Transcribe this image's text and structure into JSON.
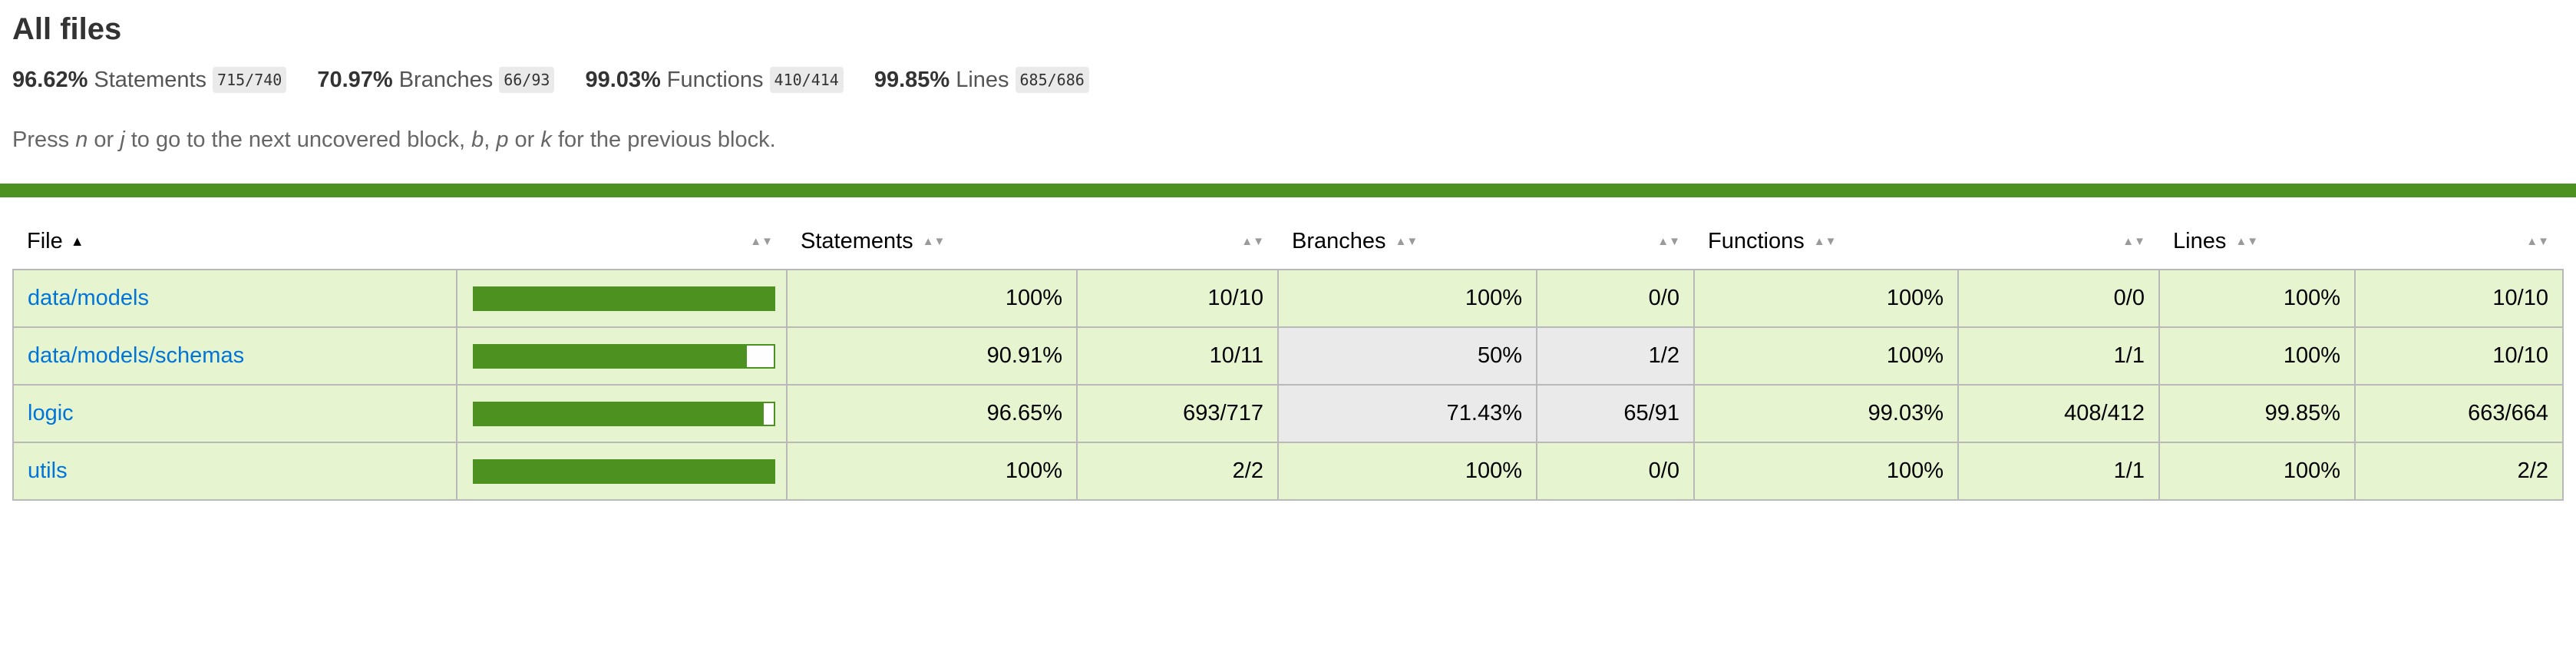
{
  "page": {
    "title": "All files",
    "hint_parts": [
      "Press ",
      "n",
      " or ",
      "j",
      " to go to the next uncovered block, ",
      "b",
      ", ",
      "p",
      " or ",
      "k",
      " for the previous block."
    ]
  },
  "summary": [
    {
      "pct": "96.62%",
      "label": "Statements",
      "fraction": "715/740"
    },
    {
      "pct": "70.97%",
      "label": "Branches",
      "fraction": "66/93"
    },
    {
      "pct": "99.03%",
      "label": "Functions",
      "fraction": "410/414"
    },
    {
      "pct": "99.85%",
      "label": "Lines",
      "fraction": "685/686"
    }
  ],
  "colors": {
    "accent_green": "#4d9221",
    "high_bg": "#e6f5d0",
    "low_bg": "#eaeaea",
    "link": "#0074d9"
  },
  "table": {
    "headers": {
      "file": "File",
      "statements": "Statements",
      "branches": "Branches",
      "functions": "Functions",
      "lines": "Lines"
    },
    "rows": [
      {
        "file": "data/models",
        "coverage_fraction": 1.0,
        "statements_pct": "100%",
        "statements": "10/10",
        "branches_pct": "100%",
        "branches": "0/0",
        "functions_pct": "100%",
        "functions": "0/0",
        "lines_pct": "100%",
        "lines": "10/10",
        "branches_low": false
      },
      {
        "file": "data/models/schemas",
        "coverage_fraction": 0.9091,
        "statements_pct": "90.91%",
        "statements": "10/11",
        "branches_pct": "50%",
        "branches": "1/2",
        "functions_pct": "100%",
        "functions": "1/1",
        "lines_pct": "100%",
        "lines": "10/10",
        "branches_low": true
      },
      {
        "file": "logic",
        "coverage_fraction": 0.9665,
        "statements_pct": "96.65%",
        "statements": "693/717",
        "branches_pct": "71.43%",
        "branches": "65/91",
        "functions_pct": "99.03%",
        "functions": "408/412",
        "lines_pct": "99.85%",
        "lines": "663/664",
        "branches_low": true
      },
      {
        "file": "utils",
        "coverage_fraction": 1.0,
        "statements_pct": "100%",
        "statements": "2/2",
        "branches_pct": "100%",
        "branches": "0/0",
        "functions_pct": "100%",
        "functions": "1/1",
        "lines_pct": "100%",
        "lines": "2/2",
        "branches_low": false
      }
    ]
  }
}
